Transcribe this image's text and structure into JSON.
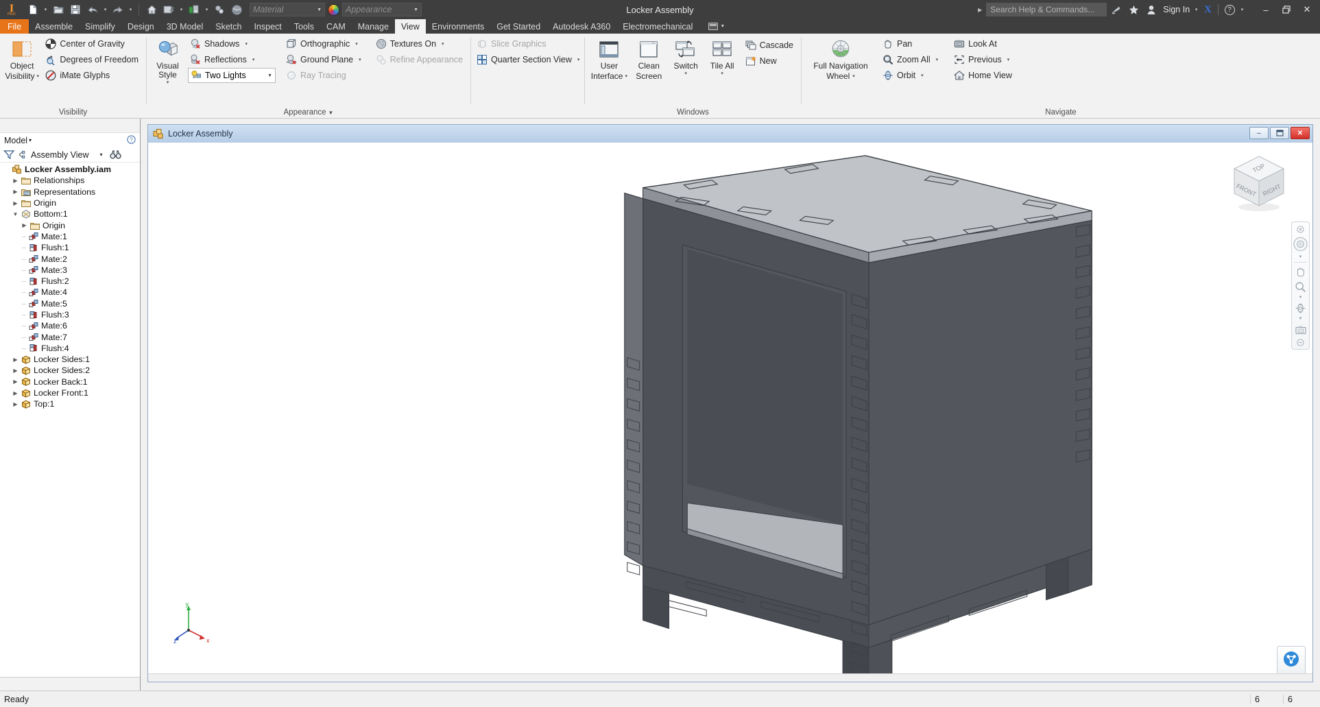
{
  "titlebar": {
    "app_title": "Locker Assembly",
    "logo": "inventor-logo",
    "quick_access": [
      {
        "name": "new-document",
        "icon": "new-file-icon",
        "has_dropdown": true
      },
      {
        "name": "open-document",
        "icon": "open-folder-icon",
        "has_dropdown": false
      },
      {
        "name": "save-document",
        "icon": "save-disk-icon",
        "has_dropdown": false
      },
      {
        "name": "undo",
        "icon": "undo-arrow-icon",
        "has_dropdown": true
      },
      {
        "name": "redo",
        "icon": "redo-arrow-icon",
        "has_dropdown": true
      },
      {
        "name": "home",
        "icon": "home-icon",
        "has_dropdown": false
      },
      {
        "name": "return",
        "icon": "return-icon",
        "has_dropdown": true
      },
      {
        "name": "update",
        "icon": "update-icon",
        "has_dropdown": true
      },
      {
        "name": "select",
        "icon": "select-icon",
        "has_dropdown": false
      },
      {
        "name": "material-browser",
        "icon": "material-sphere-icon",
        "has_dropdown": false
      }
    ],
    "material_placeholder": "Material",
    "appearance_placeholder": "Appearance",
    "search_placeholder": "Search Help & Commands...",
    "sign_in_label": "Sign In",
    "exchange_label": "X",
    "help_label": "?",
    "window_controls": {
      "minimize": "–",
      "restore": "❐",
      "close": "✕"
    }
  },
  "ribbon_tabs": [
    {
      "label": "File",
      "kind": "file"
    },
    {
      "label": "Assemble",
      "kind": "normal"
    },
    {
      "label": "Simplify",
      "kind": "normal"
    },
    {
      "label": "Design",
      "kind": "normal"
    },
    {
      "label": "3D Model",
      "kind": "normal"
    },
    {
      "label": "Sketch",
      "kind": "normal"
    },
    {
      "label": "Inspect",
      "kind": "normal"
    },
    {
      "label": "Tools",
      "kind": "normal"
    },
    {
      "label": "CAM",
      "kind": "normal"
    },
    {
      "label": "Manage",
      "kind": "normal"
    },
    {
      "label": "View",
      "kind": "active"
    },
    {
      "label": "Environments",
      "kind": "normal"
    },
    {
      "label": "Get Started",
      "kind": "normal"
    },
    {
      "label": "Autodesk A360",
      "kind": "normal"
    },
    {
      "label": "Electromechanical",
      "kind": "normal"
    }
  ],
  "ribbon": {
    "panels": [
      {
        "title": "Visibility",
        "big": {
          "label_line1": "Object",
          "label_line2": "Visibility",
          "icon": "object-visibility-icon",
          "caret": true
        },
        "items": [
          {
            "label": "Center of Gravity",
            "icon": "center-of-gravity-icon",
            "caret": false,
            "disabled": false
          },
          {
            "label": "Degrees of Freedom",
            "icon": "degrees-of-freedom-icon",
            "caret": false,
            "disabled": false
          },
          {
            "label": "iMate Glyphs",
            "icon": "imate-glyphs-icon",
            "caret": false,
            "disabled": false
          }
        ]
      },
      {
        "title": "Appearance",
        "title_caret": true,
        "big": {
          "label_line1": "Visual Style",
          "label_line2": "",
          "icon": "visual-style-icon",
          "caret": true
        },
        "items": [
          {
            "label": "Shadows",
            "icon": "shadows-icon",
            "caret": true,
            "disabled": false
          },
          {
            "label": "Reflections",
            "icon": "reflections-icon",
            "caret": true,
            "disabled": false
          },
          {
            "label": "Two Lights",
            "icon": "two-lights-icon",
            "caret": true,
            "disabled": false,
            "is_combo": true
          }
        ],
        "items2": [
          {
            "label": "Orthographic",
            "icon": "orthographic-icon",
            "caret": true,
            "disabled": false
          },
          {
            "label": "Ground Plane",
            "icon": "ground-plane-icon",
            "caret": true,
            "disabled": false
          },
          {
            "label": "Ray Tracing",
            "icon": "ray-tracing-icon",
            "caret": false,
            "disabled": true
          }
        ],
        "items3": [
          {
            "label": "Textures On",
            "icon": "textures-on-icon",
            "caret": true,
            "disabled": false
          },
          {
            "label": "Refine Appearance",
            "icon": "refine-appearance-icon",
            "caret": false,
            "disabled": true
          }
        ]
      },
      {
        "title": "",
        "items": [
          {
            "label": "Slice Graphics",
            "icon": "slice-graphics-icon",
            "caret": false,
            "disabled": true
          },
          {
            "label": "Quarter Section View",
            "icon": "quarter-section-view-icon",
            "caret": true,
            "disabled": false
          }
        ]
      },
      {
        "title": "Windows",
        "big_group": [
          {
            "label_line1": "User",
            "label_line2": "Interface",
            "icon": "user-interface-icon",
            "caret": true
          },
          {
            "label_line1": "Clean",
            "label_line2": "Screen",
            "icon": "clean-screen-icon",
            "caret": false
          },
          {
            "label_line1": "Switch",
            "label_line2": "",
            "icon": "switch-window-icon",
            "caret": true
          },
          {
            "label_line1": "Tile All",
            "label_line2": "",
            "icon": "tile-all-icon",
            "caret": true
          }
        ],
        "items": [
          {
            "label": "Cascade",
            "icon": "cascade-icon",
            "caret": false,
            "disabled": false
          },
          {
            "label": "New",
            "icon": "new-window-icon",
            "caret": false,
            "disabled": false
          }
        ]
      },
      {
        "title": "Navigate",
        "big": {
          "label_line1": "Full Navigation",
          "label_line2": "Wheel",
          "icon": "navigation-wheel-icon",
          "caret": true
        },
        "items": [
          {
            "label": "Pan",
            "icon": "pan-hand-icon",
            "caret": false,
            "disabled": false
          },
          {
            "label": "Zoom All",
            "icon": "zoom-all-icon",
            "caret": true,
            "disabled": false
          },
          {
            "label": "Orbit",
            "icon": "orbit-icon",
            "caret": true,
            "disabled": false
          }
        ],
        "items2": [
          {
            "label": "Look At",
            "icon": "look-at-icon",
            "caret": false,
            "disabled": false
          },
          {
            "label": "Previous",
            "icon": "previous-view-icon",
            "caret": true,
            "disabled": false
          },
          {
            "label": "Home View",
            "icon": "home-view-icon",
            "caret": false,
            "disabled": false
          }
        ]
      }
    ]
  },
  "browser": {
    "panel_label": "Model",
    "panel_caret": "▾",
    "help_icon": "help-circle-icon",
    "close_icon": "close-icon",
    "filter_icon": "filter-funnel-icon",
    "view_icon": "assembly-view-icon",
    "view_label": "Assembly View",
    "view_caret": "▾",
    "find_icon": "binoculars-icon",
    "tree": [
      {
        "label": "Locker Assembly.iam",
        "depth": 0,
        "icon": "assembly-icon",
        "expander": "",
        "bold": true
      },
      {
        "label": "Relationships",
        "depth": 1,
        "icon": "folder-icon",
        "expander": "collapsed",
        "bold": false
      },
      {
        "label": "Representations",
        "depth": 1,
        "icon": "representations-icon",
        "expander": "collapsed",
        "bold": false
      },
      {
        "label": "Origin",
        "depth": 1,
        "icon": "folder-icon",
        "expander": "collapsed",
        "bold": false
      },
      {
        "label": "Bottom:1",
        "depth": 1,
        "icon": "part-icon",
        "expander": "expanded",
        "bold": false
      },
      {
        "label": "Origin",
        "depth": 2,
        "icon": "folder-icon",
        "expander": "collapsed",
        "bold": false
      },
      {
        "label": "Mate:1",
        "depth": 2,
        "icon": "mate-icon",
        "expander": "leaf",
        "bold": false
      },
      {
        "label": "Flush:1",
        "depth": 2,
        "icon": "flush-icon",
        "expander": "leaf",
        "bold": false
      },
      {
        "label": "Mate:2",
        "depth": 2,
        "icon": "mate-icon",
        "expander": "leaf",
        "bold": false
      },
      {
        "label": "Mate:3",
        "depth": 2,
        "icon": "mate-icon",
        "expander": "leaf",
        "bold": false
      },
      {
        "label": "Flush:2",
        "depth": 2,
        "icon": "flush-icon",
        "expander": "leaf",
        "bold": false
      },
      {
        "label": "Mate:4",
        "depth": 2,
        "icon": "mate-icon",
        "expander": "leaf",
        "bold": false
      },
      {
        "label": "Mate:5",
        "depth": 2,
        "icon": "mate-icon",
        "expander": "leaf",
        "bold": false
      },
      {
        "label": "Flush:3",
        "depth": 2,
        "icon": "flush-icon",
        "expander": "leaf",
        "bold": false
      },
      {
        "label": "Mate:6",
        "depth": 2,
        "icon": "mate-icon",
        "expander": "leaf",
        "bold": false
      },
      {
        "label": "Mate:7",
        "depth": 2,
        "icon": "mate-icon",
        "expander": "leaf",
        "bold": false
      },
      {
        "label": "Flush:4",
        "depth": 2,
        "icon": "flush-icon",
        "expander": "leaf",
        "bold": false
      },
      {
        "label": "Locker Sides:1",
        "depth": 1,
        "icon": "part-box-icon",
        "expander": "collapsed",
        "bold": false
      },
      {
        "label": "Locker Sides:2",
        "depth": 1,
        "icon": "part-box-icon",
        "expander": "collapsed",
        "bold": false
      },
      {
        "label": "Locker Back:1",
        "depth": 1,
        "icon": "part-box-icon",
        "expander": "collapsed",
        "bold": false
      },
      {
        "label": "Locker Front:1",
        "depth": 1,
        "icon": "part-box-icon",
        "expander": "collapsed",
        "bold": false
      },
      {
        "label": "Top:1",
        "depth": 1,
        "icon": "part-box-icon",
        "expander": "collapsed",
        "bold": false
      }
    ]
  },
  "document_window": {
    "title": "Locker Assembly",
    "icon": "assembly-doc-icon",
    "minimize": "–",
    "restore": "❐",
    "close": "✕"
  },
  "viewcube": {
    "face_top": "TOP",
    "face_front": "FRONT",
    "face_right": "RIGHT"
  },
  "navbar": {
    "items": [
      {
        "name": "steering-wheel-icon",
        "caret": true
      },
      {
        "name": "pan-hand-icon",
        "caret": false
      },
      {
        "name": "zoom-magnifier-icon",
        "caret": true
      },
      {
        "name": "orbit-icon",
        "caret": true
      },
      {
        "name": "look-at-camera-icon",
        "caret": false
      }
    ],
    "close_icon": "nav-close-icon",
    "menu_icon": "nav-menu-icon"
  },
  "axis_indicator": {
    "x_label": "x",
    "y_label": "y",
    "z_label": "z",
    "x_color": "#d03030",
    "y_color": "#2fae45",
    "z_color": "#2b4fbd"
  },
  "share_button": {
    "icon": "share-a360-icon"
  },
  "statusbar": {
    "message": "Ready",
    "value_1": "6",
    "value_2": "6"
  },
  "colors": {
    "accent_orange": "#e8741a",
    "titlebar_bg": "#3e3e3e",
    "ribbon_bg": "#f2f2f2",
    "doc_title_bg": "#b6cde6",
    "model_light": "#b9bcc1",
    "model_mid": "#8d9197",
    "model_dark": "#54585e"
  }
}
